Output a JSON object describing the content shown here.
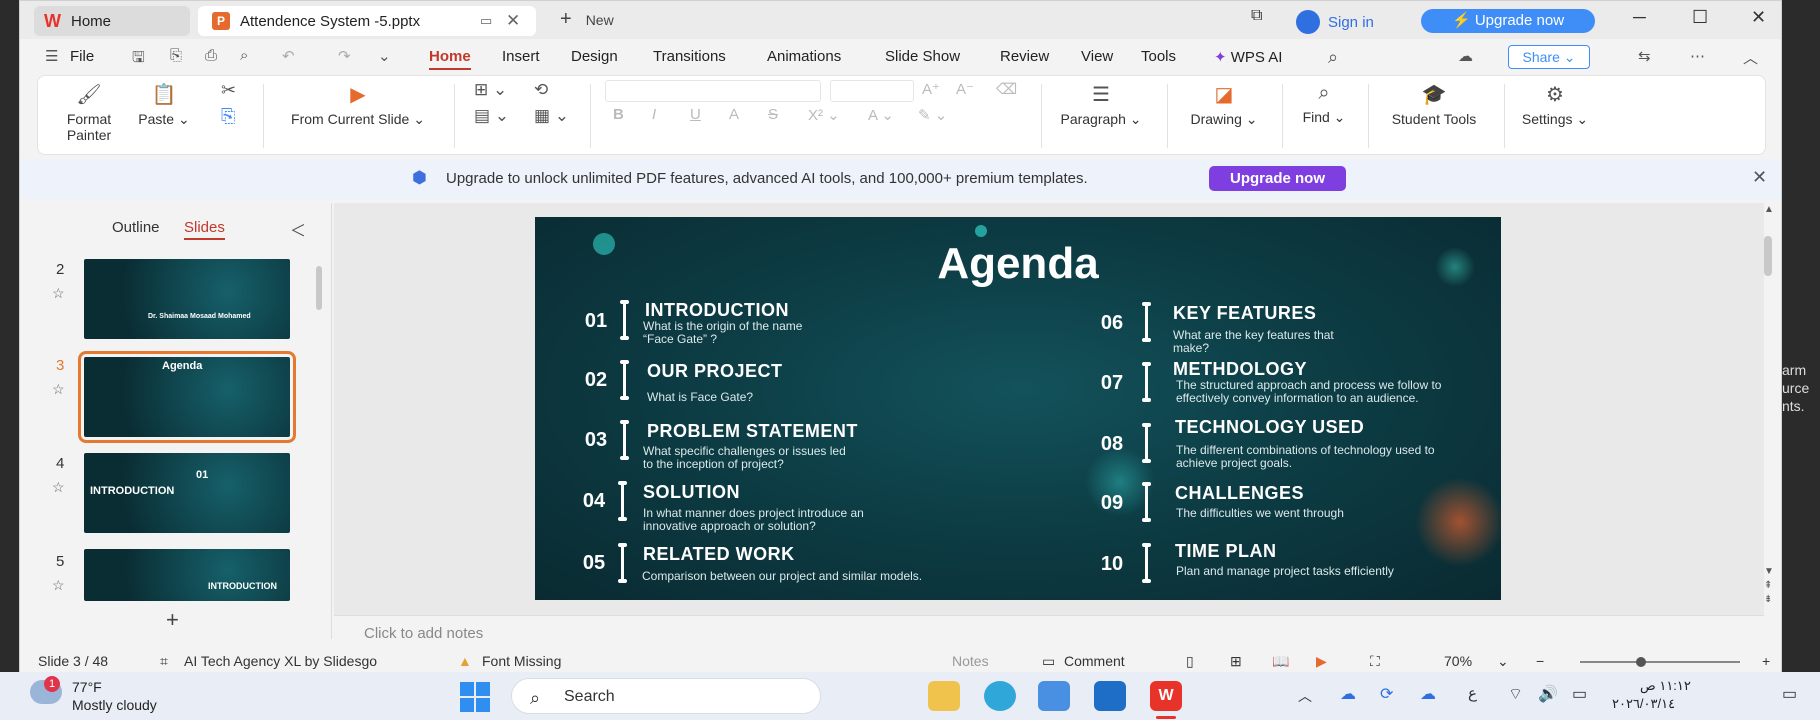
{
  "tabs": {
    "home": "Home",
    "file": "Attendence System -5.pptx",
    "new": "New",
    "sign_in": "Sign in",
    "upgrade": "Upgrade now"
  },
  "menu": {
    "file": "File",
    "items": [
      "Home",
      "Insert",
      "Design",
      "Transitions",
      "Animations",
      "Slide Show",
      "Review",
      "View",
      "Tools"
    ],
    "wps_ai": "WPS AI",
    "share": "Share"
  },
  "ribbon": {
    "format_painter": "Format Painter",
    "paste": "Paste",
    "from_current_slide": "From Current Slide",
    "paragraph": "Paragraph",
    "drawing": "Drawing",
    "find": "Find",
    "student_tools": "Student Tools",
    "settings": "Settings"
  },
  "banner": {
    "text": "Upgrade to unlock unlimited PDF features, advanced AI tools, and 100,000+ premium templates.",
    "button": "Upgrade now"
  },
  "panel": {
    "outline": "Outline",
    "slides": "Slides",
    "thumbs": [
      {
        "num": "2",
        "caption": "Dr. Shaimaa Mosaad Mohamed"
      },
      {
        "num": "3",
        "caption": "Agenda"
      },
      {
        "num": "4",
        "caption": "INTRODUCTION"
      },
      {
        "num": "5",
        "caption": "INTRODUCTION"
      }
    ]
  },
  "slide": {
    "title": "Agenda",
    "items": [
      {
        "num": "01",
        "head": "INTRODUCTION",
        "desc": "What is the origin of the name “Face Gate” ?"
      },
      {
        "num": "02",
        "head": "OUR PROJECT",
        "desc": "What is Face Gate?"
      },
      {
        "num": "03",
        "head": "PROBLEM STATEMENT",
        "desc": "What specific challenges or issues led to the inception of project?"
      },
      {
        "num": "04",
        "head": "SOLUTION",
        "desc": "In what manner does project introduce an innovative approach or solution?"
      },
      {
        "num": "05",
        "head": "RELATED WORK",
        "desc": "Comparison between our project and similar models."
      },
      {
        "num": "06",
        "head": "KEY FEATURES",
        "desc": "What are the key features that make?"
      },
      {
        "num": "07",
        "head": "METHDOLOGY",
        "desc": "The structured approach and process we follow to effectively convey information to an audience."
      },
      {
        "num": "08",
        "head": "TECHNOLOGY USED",
        "desc": "The different combinations of technology used to achieve project goals."
      },
      {
        "num": "09",
        "head": "CHALLENGES",
        "desc": "The difficulties we went through"
      },
      {
        "num": "10",
        "head": "TIME PLAN",
        "desc": "Plan and manage project tasks efficiently"
      }
    ]
  },
  "notes_placeholder": "Click to add notes",
  "status": {
    "slide": "Slide 3 / 48",
    "theme": "AI Tech Agency XL by Slidesgo",
    "font_missing": "Font Missing",
    "notes": "Notes",
    "comment": "Comment",
    "zoom": "70%"
  },
  "taskbar": {
    "temp": "77°F",
    "weather": "Mostly cloudy",
    "weather_badge": "1",
    "search": "Search",
    "time": "١١:١٢ ص",
    "date": "٢٠٢٦/٠٣/١٤",
    "lang": "ع"
  },
  "right_edge_text": [
    "arm",
    "urce",
    "nts."
  ],
  "colors": {
    "accent": "#c0392b",
    "brand": "#3f8ef7",
    "upgrade_purple": "#7f3fe0",
    "slide_bg": "#0d3d45"
  }
}
